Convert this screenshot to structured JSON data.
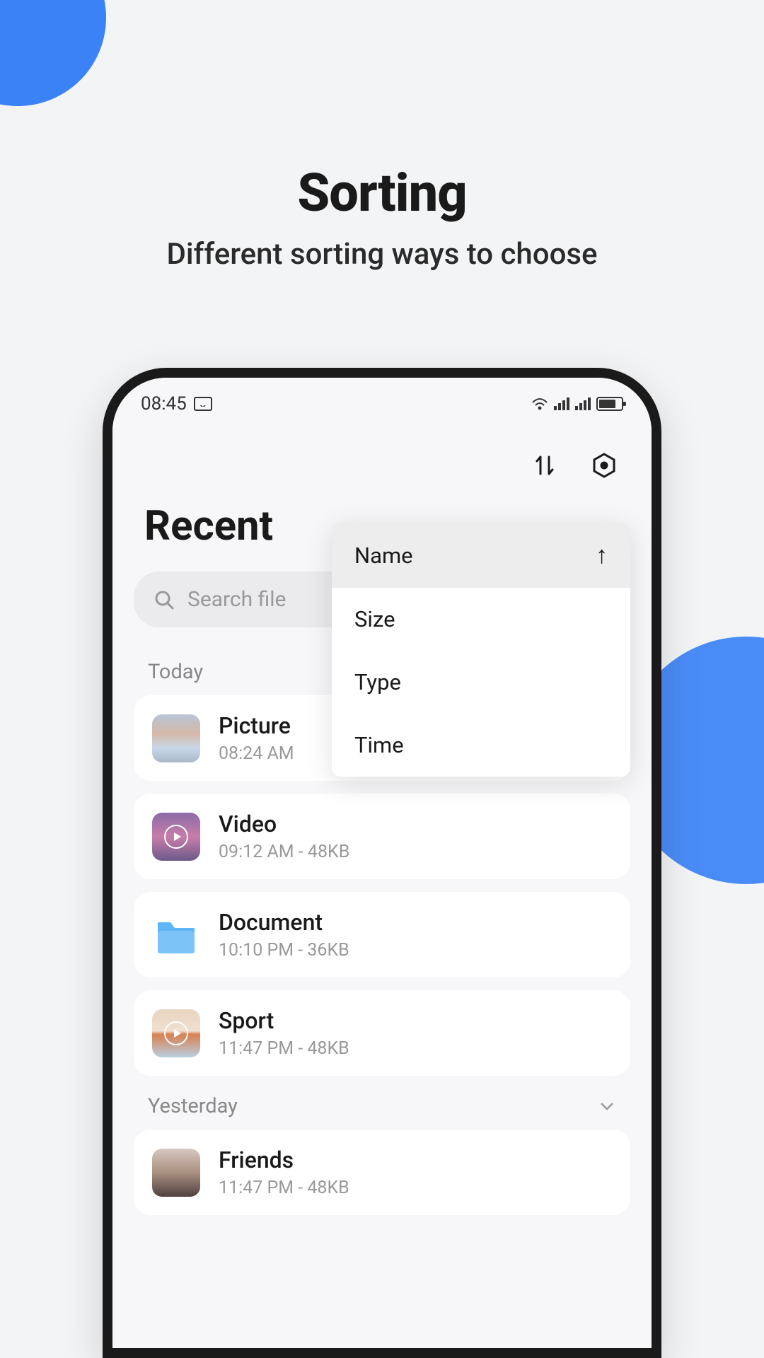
{
  "promo": {
    "title": "Sorting",
    "subtitle": "Different sorting ways to choose"
  },
  "status_bar": {
    "time": "08:45"
  },
  "page": {
    "title": "Recent"
  },
  "search": {
    "placeholder": "Search file"
  },
  "sort_menu": {
    "options": [
      {
        "label": "Name",
        "selected": true,
        "direction": "asc"
      },
      {
        "label": "Size"
      },
      {
        "label": "Type"
      },
      {
        "label": "Time"
      }
    ]
  },
  "sections": [
    {
      "label": "Today",
      "items": [
        {
          "name": "Picture",
          "meta": "08:24 AM",
          "thumb": "picture"
        },
        {
          "name": "Video",
          "meta": "09:12 AM - 48KB",
          "thumb": "video"
        },
        {
          "name": "Document",
          "meta": "10:10 PM - 36KB",
          "thumb": "folder"
        },
        {
          "name": "Sport",
          "meta": "11:47 PM - 48KB",
          "thumb": "sport"
        }
      ]
    },
    {
      "label": "Yesterday",
      "items": [
        {
          "name": "Friends",
          "meta": "11:47 PM - 48KB",
          "thumb": "friends"
        }
      ]
    }
  ]
}
